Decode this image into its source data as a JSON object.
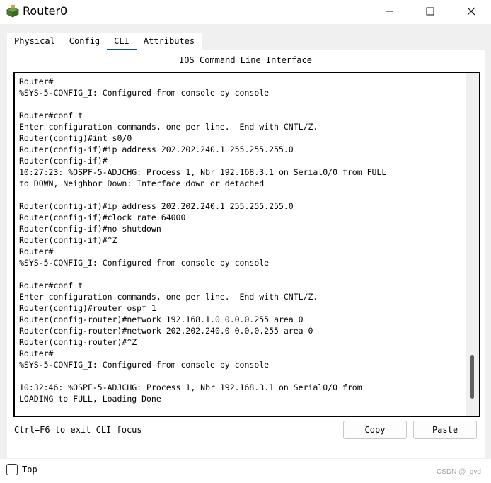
{
  "window": {
    "title": "Router0",
    "icon": "router-app-icon",
    "controls": {
      "minimize": "—",
      "maximize": "☐",
      "close": "✕"
    }
  },
  "tabs": [
    {
      "label": "Physical",
      "active": false
    },
    {
      "label": "Config",
      "active": false
    },
    {
      "label": "CLI",
      "active": true
    },
    {
      "label": "Attributes",
      "active": false
    }
  ],
  "cli": {
    "panel_title": "IOS Command Line Interface",
    "lines": [
      "Router#",
      "%SYS-5-CONFIG_I: Configured from console by console",
      "",
      "Router#conf t",
      "Enter configuration commands, one per line.  End with CNTL/Z.",
      "Router(config)#int s0/0",
      "Router(config-if)#ip address 202.202.240.1 255.255.255.0",
      "Router(config-if)#",
      "10:27:23: %OSPF-5-ADJCHG: Process 1, Nbr 192.168.3.1 on Serial0/0 from FULL",
      "to DOWN, Neighbor Down: Interface down or detached",
      "",
      "Router(config-if)#ip address 202.202.240.1 255.255.255.0",
      "Router(config-if)#clock rate 64000",
      "Router(config-if)#no shutdown",
      "Router(config-if)#^Z",
      "Router#",
      "%SYS-5-CONFIG_I: Configured from console by console",
      "",
      "Router#conf t",
      "Enter configuration commands, one per line.  End with CNTL/Z.",
      "Router(config)#router ospf 1",
      "Router(config-router)#network 192.168.1.0 0.0.0.255 area 0",
      "Router(config-router)#network 202.202.240.0 0.0.0.255 area 0",
      "Router(config-router)#^Z",
      "Router#",
      "%SYS-5-CONFIG_I: Configured from console by console",
      "",
      "10:32:46: %OSPF-5-ADJCHG: Process 1, Nbr 192.168.3.1 on Serial0/0 from",
      "LOADING to FULL, Loading Done"
    ]
  },
  "footer": {
    "hint": "Ctrl+F6 to exit CLI focus",
    "copy_label": "Copy",
    "paste_label": "Paste"
  },
  "bottom_bar": {
    "top_label": "Top",
    "top_checked": false,
    "watermark": "CSDN @_gyd"
  }
}
